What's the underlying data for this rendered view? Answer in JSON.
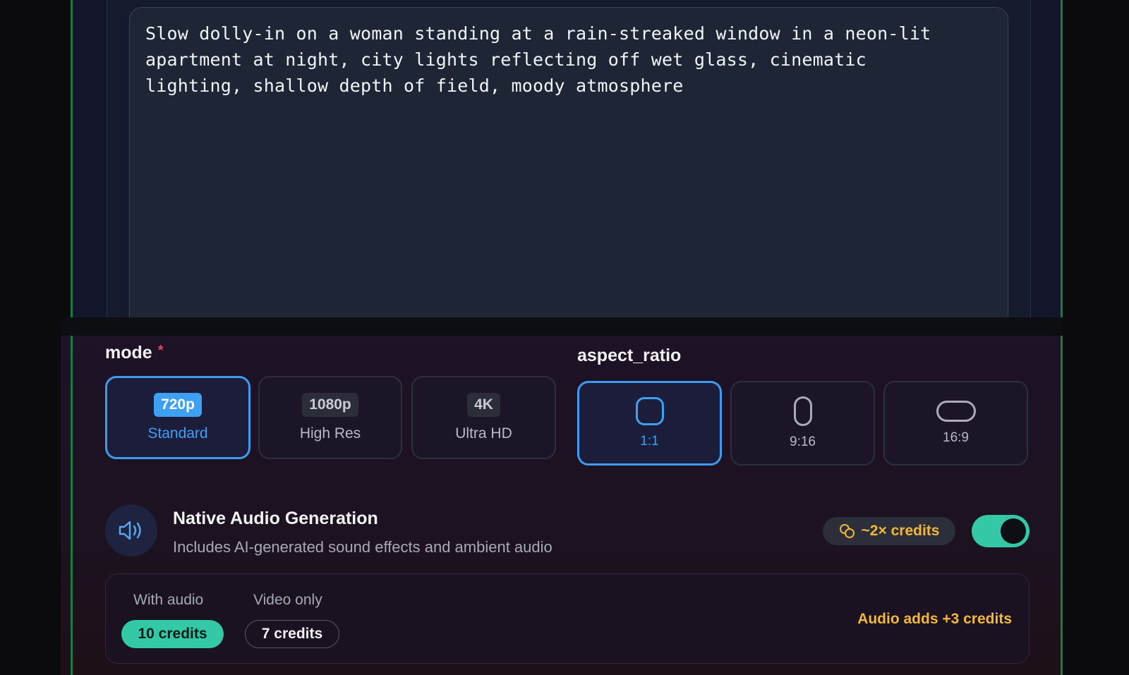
{
  "prompt": {
    "text": "Slow dolly-in on a woman standing at a rain-streaked window in a neon-lit\napartment at night, city lights reflecting off wet glass, cinematic\nlighting, shallow depth of field, moody atmosphere"
  },
  "mode": {
    "label": "mode",
    "required_mark": "*",
    "options": [
      {
        "badge": "720p",
        "label": "Standard",
        "selected": true
      },
      {
        "badge": "1080p",
        "label": "High Res",
        "selected": false
      },
      {
        "badge": "4K",
        "label": "Ultra HD",
        "selected": false
      }
    ]
  },
  "aspect_ratio": {
    "label": "aspect_ratio",
    "options": [
      {
        "label": "1:1",
        "icon": "square-icon",
        "selected": true
      },
      {
        "label": "9:16",
        "icon": "portrait-icon",
        "selected": false
      },
      {
        "label": "16:9",
        "icon": "landscape-icon",
        "selected": false
      }
    ]
  },
  "audio": {
    "icon": "speaker-icon",
    "title": "Native Audio Generation",
    "description": "Includes AI-generated sound effects and ambient audio",
    "credit_chip": "~2× credits",
    "credit_chip_icon": "coins-icon",
    "enabled": true
  },
  "cost": {
    "with_audio_label": "With audio",
    "with_audio_value": "10 credits",
    "video_only_label": "Video only",
    "video_only_value": "7 credits",
    "note": "Audio adds +3 credits"
  },
  "colors": {
    "accent_blue": "#3ea0f3",
    "accent_teal": "#33c9a6",
    "accent_gold": "#f2b83a"
  }
}
